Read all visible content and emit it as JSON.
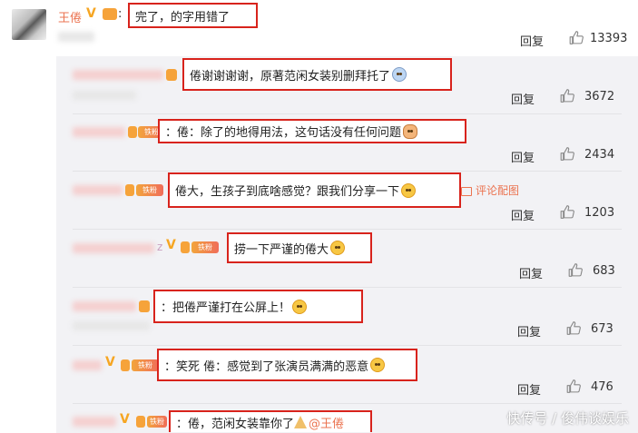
{
  "main_post": {
    "author": "王倦",
    "verified_mark": "V",
    "content": "完了，的字用错了",
    "reply_label": "回复",
    "likes": "13393"
  },
  "replies": [
    {
      "content": "倦谢谢谢谢，原著范闲女装别删拜托了",
      "reply_label": "回复",
      "likes": "3672"
    },
    {
      "content": "：倦：除了的地得用法，这句话没有任何问题",
      "reply_label": "回复",
      "likes": "2434",
      "fan_badge": "铁粉"
    },
    {
      "content": "倦大，生孩子到底啥感觉？跟我们分享一下",
      "reply_label": "回复",
      "likes": "1203",
      "fan_badge": "铁粉",
      "side_link": "评论配图"
    },
    {
      "content": "捞一下严谨的倦大",
      "reply_label": "回复",
      "likes": "683",
      "fan_badge": "铁粉",
      "letter": "z"
    },
    {
      "content": "：把倦严谨打在公屏上！",
      "reply_label": "回复",
      "likes": "673"
    },
    {
      "content": "：笑死 倦：感觉到了张演员满满的恶意",
      "reply_label": "回复",
      "likes": "476",
      "fan_badge": "铁粉"
    },
    {
      "content": "：倦，范闲女装靠你了",
      "mention": "@王倦",
      "fan_badge": "铁粉"
    }
  ],
  "watermark": "快传号 / 俊伟谈娱乐",
  "colors": {
    "highlight_border": "#d8231c",
    "username": "#eb7350",
    "sub_background": "#f2f2f5"
  },
  "icons": [
    "thumbs-up-icon",
    "verified-v-icon",
    "fan-badge-icon",
    "emoji-icon",
    "image-icon"
  ]
}
